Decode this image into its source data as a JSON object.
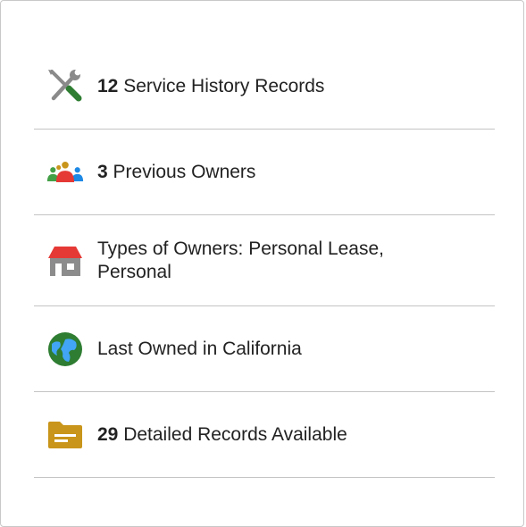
{
  "items": [
    {
      "icon": "tools-icon",
      "count": "12",
      "text": "Service History Records"
    },
    {
      "icon": "owners-icon",
      "count": "3",
      "text": "Previous Owners"
    },
    {
      "icon": "house-icon",
      "count": "",
      "text": "Types of Owners: Personal Lease, Personal"
    },
    {
      "icon": "globe-icon",
      "count": "",
      "text": "Last Owned in California"
    },
    {
      "icon": "folder-icon",
      "count": "29",
      "text": "Detailed Records Available"
    }
  ],
  "colors": {
    "tool_gray": "#8a8a8a",
    "tool_green": "#2e7d32",
    "owner_green": "#43a047",
    "owner_gold": "#c9951a",
    "owner_red": "#e53935",
    "owner_blue": "#1e88e5",
    "house_red": "#e53935",
    "house_gray": "#8c8c8c",
    "globe_green": "#2e7d32",
    "globe_blue": "#42a5f5",
    "folder_gold": "#c9951a",
    "text": "#222222",
    "divider": "#c4c4c4"
  }
}
